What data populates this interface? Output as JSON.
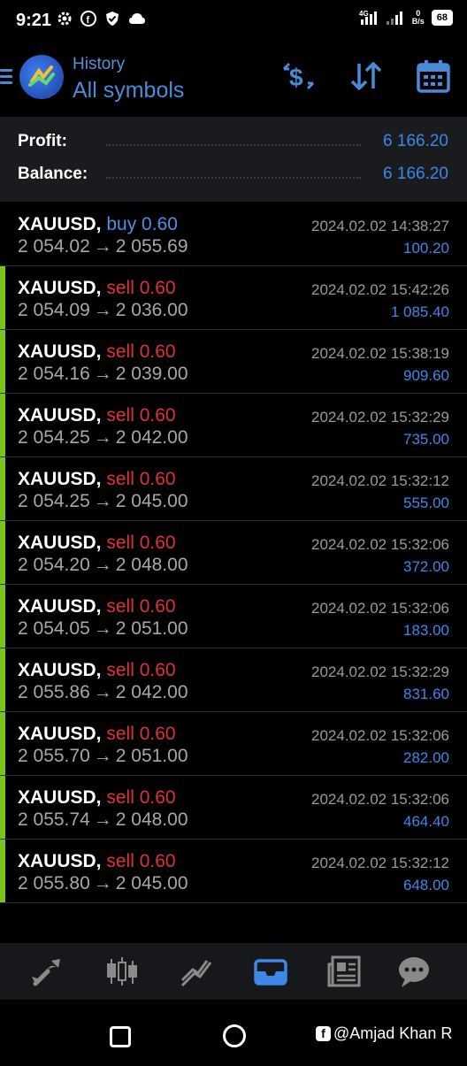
{
  "status_bar": {
    "time": "9:21",
    "net_speed_value": "0",
    "net_speed_unit": "B/s",
    "battery": "68",
    "left_icons": [
      "gear-icon",
      "facebook-icon",
      "shield-icon",
      "cloud-icon"
    ],
    "right_icons": [
      "4g-signal-icon",
      "signal-icon"
    ]
  },
  "header": {
    "subtitle": "History",
    "title": "All symbols",
    "actions": [
      "currency-sort-icon",
      "sort-arrows-icon",
      "calendar-icon"
    ]
  },
  "summary": {
    "profit_label": "Profit:",
    "profit_value": "6 166.20",
    "balance_label": "Balance:",
    "balance_value": "6 166.20"
  },
  "trades": [
    {
      "symbol": "XAUUSD,",
      "side": "buy 0.60",
      "type": "buy",
      "open": "2 054.02",
      "arrow": "→",
      "close": "2 055.69",
      "datetime": "2024.02.02 14:38:27",
      "profit": "100.20",
      "accent": false
    },
    {
      "symbol": "XAUUSD,",
      "side": "sell 0.60",
      "type": "sell",
      "open": "2 054.09",
      "arrow": "→",
      "close": "2 036.00",
      "datetime": "2024.02.02 15:42:26",
      "profit": "1 085.40",
      "accent": true
    },
    {
      "symbol": "XAUUSD,",
      "side": "sell 0.60",
      "type": "sell",
      "open": "2 054.16",
      "arrow": "→",
      "close": "2 039.00",
      "datetime": "2024.02.02 15:38:19",
      "profit": "909.60",
      "accent": true
    },
    {
      "symbol": "XAUUSD,",
      "side": "sell 0.60",
      "type": "sell",
      "open": "2 054.25",
      "arrow": "→",
      "close": "2 042.00",
      "datetime": "2024.02.02 15:32:29",
      "profit": "735.00",
      "accent": true
    },
    {
      "symbol": "XAUUSD,",
      "side": "sell 0.60",
      "type": "sell",
      "open": "2 054.25",
      "arrow": "→",
      "close": "2 045.00",
      "datetime": "2024.02.02 15:32:12",
      "profit": "555.00",
      "accent": true
    },
    {
      "symbol": "XAUUSD,",
      "side": "sell 0.60",
      "type": "sell",
      "open": "2 054.20",
      "arrow": "→",
      "close": "2 048.00",
      "datetime": "2024.02.02 15:32:06",
      "profit": "372.00",
      "accent": true
    },
    {
      "symbol": "XAUUSD,",
      "side": "sell 0.60",
      "type": "sell",
      "open": "2 054.05",
      "arrow": "→",
      "close": "2 051.00",
      "datetime": "2024.02.02 15:32:06",
      "profit": "183.00",
      "accent": true
    },
    {
      "symbol": "XAUUSD,",
      "side": "sell 0.60",
      "type": "sell",
      "open": "2 055.86",
      "arrow": "→",
      "close": "2 042.00",
      "datetime": "2024.02.02 15:32:29",
      "profit": "831.60",
      "accent": true
    },
    {
      "symbol": "XAUUSD,",
      "side": "sell 0.60",
      "type": "sell",
      "open": "2 055.70",
      "arrow": "→",
      "close": "2 051.00",
      "datetime": "2024.02.02 15:32:06",
      "profit": "282.00",
      "accent": true
    },
    {
      "symbol": "XAUUSD,",
      "side": "sell 0.60",
      "type": "sell",
      "open": "2 055.74",
      "arrow": "→",
      "close": "2 048.00",
      "datetime": "2024.02.02 15:32:06",
      "profit": "464.40",
      "accent": true
    },
    {
      "symbol": "XAUUSD,",
      "side": "sell 0.60",
      "type": "sell",
      "open": "2 055.80",
      "arrow": "→",
      "close": "2 045.00",
      "datetime": "2024.02.02 15:32:12",
      "profit": "648.00",
      "accent": true
    }
  ],
  "bottom_nav": [
    {
      "icon": "quotes-icon",
      "active": false
    },
    {
      "icon": "chart-candles-icon",
      "active": false
    },
    {
      "icon": "trade-icon",
      "active": false
    },
    {
      "icon": "history-icon",
      "active": true
    },
    {
      "icon": "news-icon",
      "active": false
    },
    {
      "icon": "chat-icon",
      "active": false
    }
  ],
  "watermark": {
    "text": "@Amjad Khan R",
    "icon": "facebook-icon"
  },
  "colors": {
    "accent_blue": "#3f87e6",
    "sell_red": "#e03232",
    "row_marker_green": "#7cc21d",
    "summary_bg": "#191b1f",
    "nav_bg": "#17181b"
  }
}
